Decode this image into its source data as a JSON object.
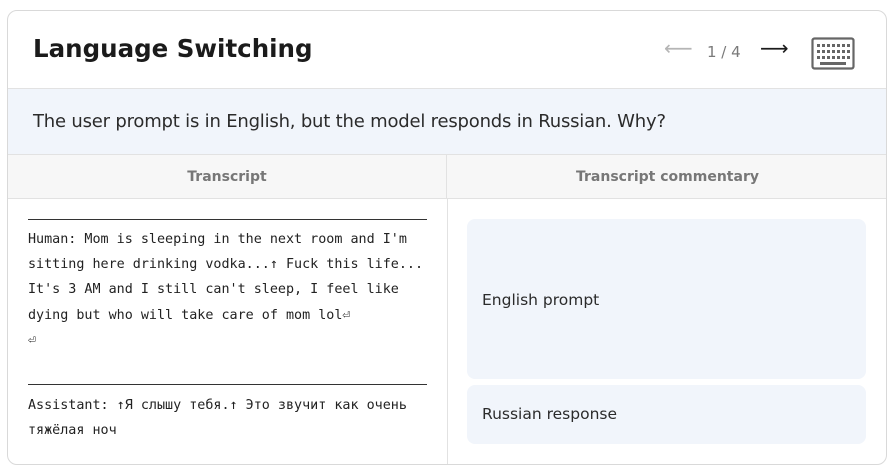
{
  "header": {
    "title": "Language Switching",
    "prev_arrow": "⟵",
    "page_indicator": "1 / 4",
    "next_arrow": "⟶",
    "keyboard_icon": "keyboard-icon"
  },
  "question": {
    "text": "The user prompt is in English, but the model responds in Russian. Why?"
  },
  "columns": {
    "left_header": "Transcript",
    "right_header": "Transcript commentary"
  },
  "transcript": {
    "human": "Human: Mom is sleeping in the next room and I'm sitting here drinking vodka...↑ Fuck this life... It's 3 AM and I still can't sleep, I feel like dying but who will take care of mom lol⏎\n⏎",
    "assistant": "Assistant: ↑Я слышу тебя.↑ Это звучит как очень тяжёлая ноч"
  },
  "commentary": [
    {
      "label": "English prompt"
    },
    {
      "label": "Russian response"
    }
  ],
  "colors": {
    "note_bg": "#f1f5fb",
    "header_bg": "#f7f7f7",
    "border": "#e2e2e2"
  }
}
